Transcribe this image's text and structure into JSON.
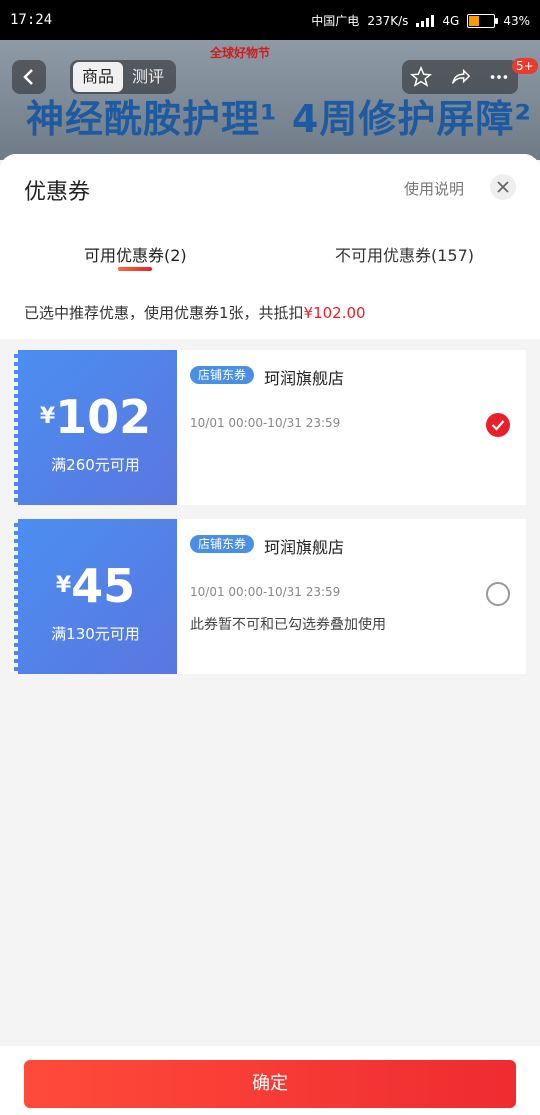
{
  "status_bar": {
    "time": "17:24",
    "carrier": "中国广电",
    "speed": "237K/s",
    "network": "4G",
    "battery_percent": "43%",
    "battery_level": 0.43,
    "battery_color": "#ff9900"
  },
  "background_page": {
    "brand": "全球好物节",
    "headline": "神经酰胺护理¹ 4周修护屏障²",
    "tabs": [
      "商品",
      "测评"
    ],
    "active_tab": "商品",
    "badge": "5+"
  },
  "sheet": {
    "title": "优惠券",
    "help": "使用说明",
    "tabs": {
      "available": "可用优惠券(2)",
      "unavailable": "不可用优惠券(157)"
    },
    "summary_prefix": "已选中推荐优惠，使用优惠券1张，共抵扣",
    "summary_amount": "¥102.00",
    "accent_color": "#e8202a"
  },
  "coupons": [
    {
      "currency": "¥",
      "amount": "102",
      "condition": "满260元可用",
      "tag": "店铺东券",
      "shop": "珂润旗舰店",
      "valid": "10/01 00:00-10/31 23:59",
      "note": "",
      "selected": true
    },
    {
      "currency": "¥",
      "amount": "45",
      "condition": "满130元可用",
      "tag": "店铺东券",
      "shop": "珂润旗舰店",
      "valid": "10/01 00:00-10/31 23:59",
      "note": "此券暂不可和已勾选券叠加使用",
      "selected": false
    }
  ],
  "footer": {
    "confirm_label": "确定"
  },
  "icons": {
    "back": "chevron-left-icon",
    "star": "star-icon",
    "share": "share-icon",
    "more": "more-icon",
    "close": "close-icon",
    "check": "check-icon"
  }
}
